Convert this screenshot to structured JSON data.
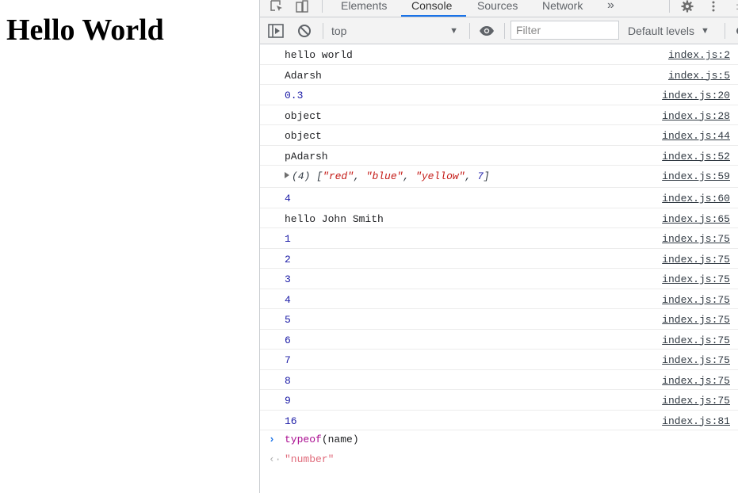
{
  "page": {
    "heading": "Hello World"
  },
  "devtools": {
    "tabs": [
      "Elements",
      "Console",
      "Sources",
      "Network"
    ],
    "active_tab": "Console",
    "more_tabs_glyph": "»",
    "icons": {
      "inspect": "inspect-element-icon",
      "device": "device-toggle-icon",
      "settings": "gear-icon",
      "menu": "kebab-menu-icon",
      "sidebar": "console-sidebar-icon",
      "clear": "clear-console-icon",
      "eye": "live-expression-eye-icon"
    },
    "toolbar": {
      "context": "top",
      "filter_placeholder": "Filter",
      "levels": "Default levels"
    },
    "logs": [
      {
        "text": "hello world",
        "type": "string",
        "source": "index.js:2"
      },
      {
        "text": "Adarsh",
        "type": "string",
        "source": "index.js:5"
      },
      {
        "text": "0.3",
        "type": "number",
        "source": "index.js:20"
      },
      {
        "text": "object",
        "type": "string",
        "source": "index.js:28"
      },
      {
        "text": "object",
        "type": "string",
        "source": "index.js:44"
      },
      {
        "text": "pAdarsh",
        "type": "string",
        "source": "index.js:52"
      },
      {
        "type": "array",
        "length": "(4)",
        "items": [
          "\"red\"",
          "\"blue\"",
          "\"yellow\"",
          "7"
        ],
        "source": "index.js:59"
      },
      {
        "text": "4",
        "type": "number",
        "source": "index.js:60"
      },
      {
        "text": "hello John Smith",
        "type": "string",
        "source": "index.js:65"
      },
      {
        "text": "1",
        "type": "number",
        "source": "index.js:75"
      },
      {
        "text": "2",
        "type": "number",
        "source": "index.js:75"
      },
      {
        "text": "3",
        "type": "number",
        "source": "index.js:75"
      },
      {
        "text": "4",
        "type": "number",
        "source": "index.js:75"
      },
      {
        "text": "5",
        "type": "number",
        "source": "index.js:75"
      },
      {
        "text": "6",
        "type": "number",
        "source": "index.js:75"
      },
      {
        "text": "7",
        "type": "number",
        "source": "index.js:75"
      },
      {
        "text": "8",
        "type": "number",
        "source": "index.js:75"
      },
      {
        "text": "9",
        "type": "number",
        "source": "index.js:75"
      },
      {
        "text": "16",
        "type": "number",
        "source": "index.js:81"
      }
    ],
    "input": {
      "keyword": "typeof",
      "rest": "(name)"
    },
    "result": "\"number\""
  }
}
